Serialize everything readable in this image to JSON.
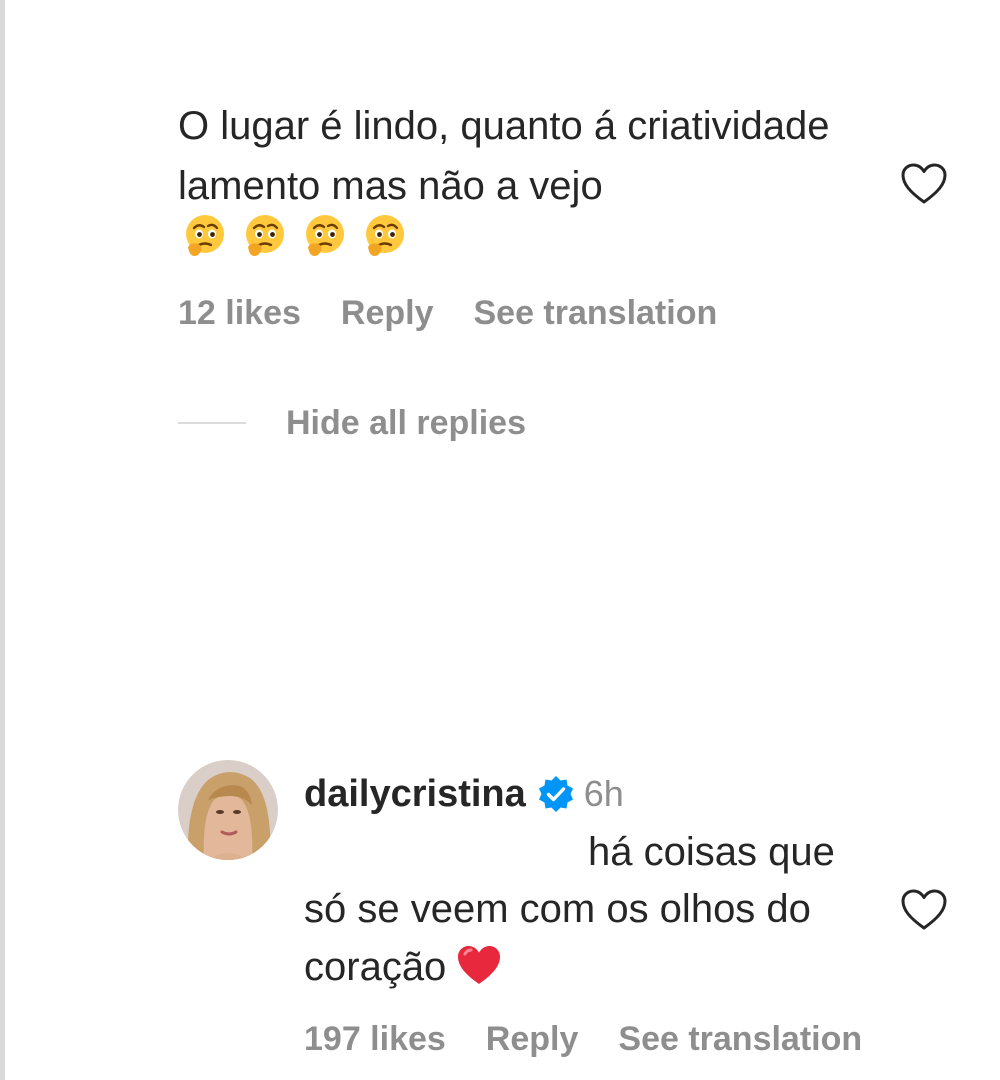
{
  "comment": {
    "text": "O lugar é lindo, quanto á criatividade lamento mas não a vejo",
    "emojis": [
      "thinking-face-with-raised-eyebrow",
      "thinking-face-with-raised-eyebrow",
      "thinking-face-with-raised-eyebrow",
      "thinking-face-with-raised-eyebrow"
    ],
    "likes": "12 likes",
    "reply_label": "Reply",
    "translate_label": "See translation"
  },
  "replies_toggle": {
    "label": "Hide all replies"
  },
  "reply": {
    "username": "dailycristina",
    "verified": true,
    "time": "6h",
    "text_line1": "há coisas que",
    "text_line2": "só se veem com os olhos do",
    "text_line3": "coração",
    "emoji": "red-heart",
    "likes": "197 likes",
    "reply_label": "Reply",
    "translate_label": "See translation"
  },
  "colors": {
    "text": "#262626",
    "secondary": "#8e8e8e",
    "verified": "#0095f6",
    "heart_red": "#e0245e"
  }
}
